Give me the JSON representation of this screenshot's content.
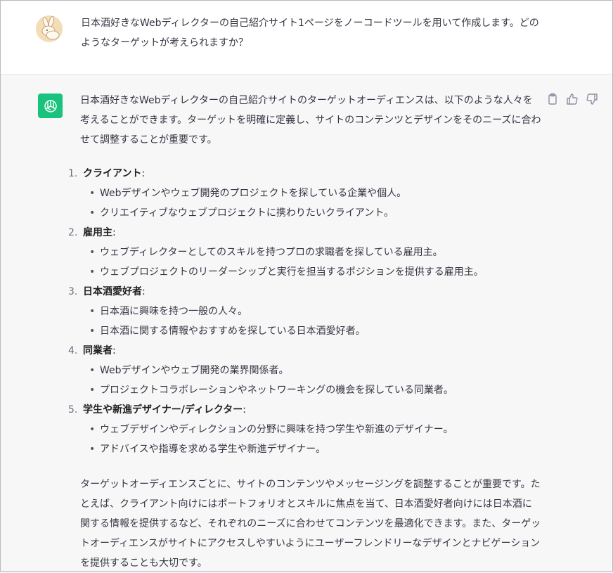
{
  "user": {
    "avatar_icon": "rabbit-avatar-icon",
    "message": "日本酒好きなWebディレクターの自己紹介サイト1ページをノーコードツールを用いて作成します。どのようなターゲットが考えられますか？"
  },
  "assistant": {
    "avatar_icon": "openai-logo-icon",
    "intro": "日本酒好きなWebディレクターの自己紹介サイトのターゲットオーディエンスは、以下のような人々を考えることができます。ターゲットを明確に定義し、サイトのコンテンツとデザインをそのニーズに合わせて調整することが重要です。",
    "items": [
      {
        "num": "1.",
        "title": "クライアント",
        "colon": ":",
        "bullets": [
          "Webデザインやウェブ開発のプロジェクトを探している企業や個人。",
          "クリエイティブなウェブプロジェクトに携わりたいクライアント。"
        ]
      },
      {
        "num": "2.",
        "title": "雇用主",
        "colon": ":",
        "bullets": [
          "ウェブディレクターとしてのスキルを持つプロの求職者を探している雇用主。",
          "ウェブプロジェクトのリーダーシップと実行を担当するポジションを提供する雇用主。"
        ]
      },
      {
        "num": "3.",
        "title": "日本酒愛好者",
        "colon": ":",
        "bullets": [
          "日本酒に興味を持つ一般の人々。",
          "日本酒に関する情報やおすすめを探している日本酒愛好者。"
        ]
      },
      {
        "num": "4.",
        "title": "同業者",
        "colon": ":",
        "bullets": [
          "Webデザインやウェブ開発の業界関係者。",
          "プロジェクトコラボレーションやネットワーキングの機会を探している同業者。"
        ]
      },
      {
        "num": "5.",
        "title": "学生や新進デザイナー/ディレクター",
        "colon": ":",
        "bullets": [
          "ウェブデザインやディレクションの分野に興味を持つ学生や新進のデザイナー。",
          "アドバイスや指導を求める学生や新進デザイナー。"
        ]
      }
    ],
    "outro": "ターゲットオーディエンスごとに、サイトのコンテンツやメッセージングを調整することが重要です。たとえば、クライアント向けにはポートフォリオとスキルに焦点を当て、日本酒愛好者向けには日本酒に関する情報を提供するなど、それぞれのニーズに合わせてコンテンツを最適化できます。また、ターゲットオーディエンスがサイトにアクセスしやすいようにユーザーフレンドリーなデザインとナビゲーションを提供することも大切です。"
  },
  "actions": {
    "copy_icon": "clipboard-icon",
    "like_icon": "thumbs-up-icon",
    "dislike_icon": "thumbs-down-icon"
  },
  "colors": {
    "accent": "#19c37d",
    "user_bg": "#ffffff",
    "assistant_bg": "#f7f7f8",
    "text": "#343541"
  }
}
